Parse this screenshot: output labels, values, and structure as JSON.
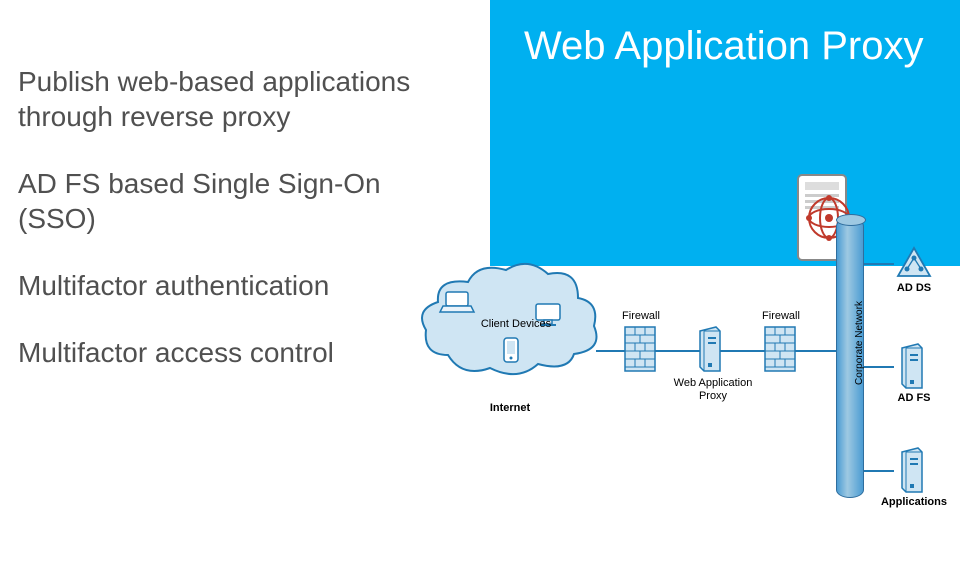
{
  "banner": {
    "title": "Web Application Proxy"
  },
  "bullets": {
    "b1": "Publish web-based applications through reverse proxy",
    "b2": "AD FS based Single Sign-On (SSO)",
    "b3": "Multifactor authentication",
    "b4": "Multifactor access control"
  },
  "diagram": {
    "client_devices": "Client Devices",
    "internet": "Internet",
    "firewall1": "Firewall",
    "firewall2": "Firewall",
    "wap": "Web Application Proxy",
    "corp_net": "Corporate Network",
    "adds": "AD DS",
    "adfs": "AD FS",
    "apps": "Applications"
  },
  "colors": {
    "banner_bg": "#00b0f0",
    "icon_blue": "#2079b3",
    "icon_fill": "#cfe5f3",
    "atom_red": "#c0392b"
  }
}
